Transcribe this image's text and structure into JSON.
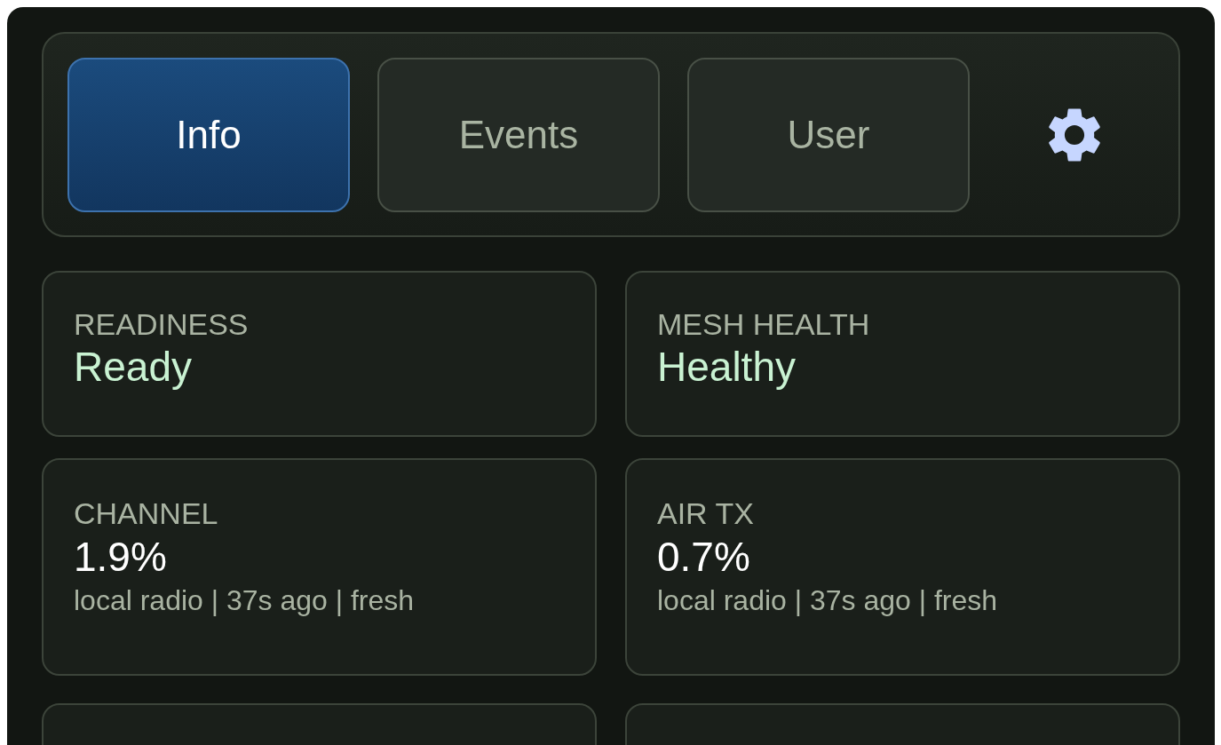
{
  "tabs": [
    {
      "label": "Info",
      "selected": true
    },
    {
      "label": "Events",
      "selected": false
    },
    {
      "label": "User",
      "selected": false
    }
  ],
  "cards": [
    {
      "kind": "status",
      "label": "READINESS",
      "value": "Ready"
    },
    {
      "kind": "status",
      "label": "MESH HEALTH",
      "value": "Healthy"
    },
    {
      "kind": "metric",
      "label": "CHANNEL",
      "value": "1.9%",
      "detail": "local radio | 37s ago | fresh"
    },
    {
      "kind": "metric",
      "label": "AIR TX",
      "value": "0.7%",
      "detail": "local radio | 37s ago | fresh"
    },
    {
      "kind": "clipped"
    },
    {
      "kind": "clipped"
    }
  ]
}
